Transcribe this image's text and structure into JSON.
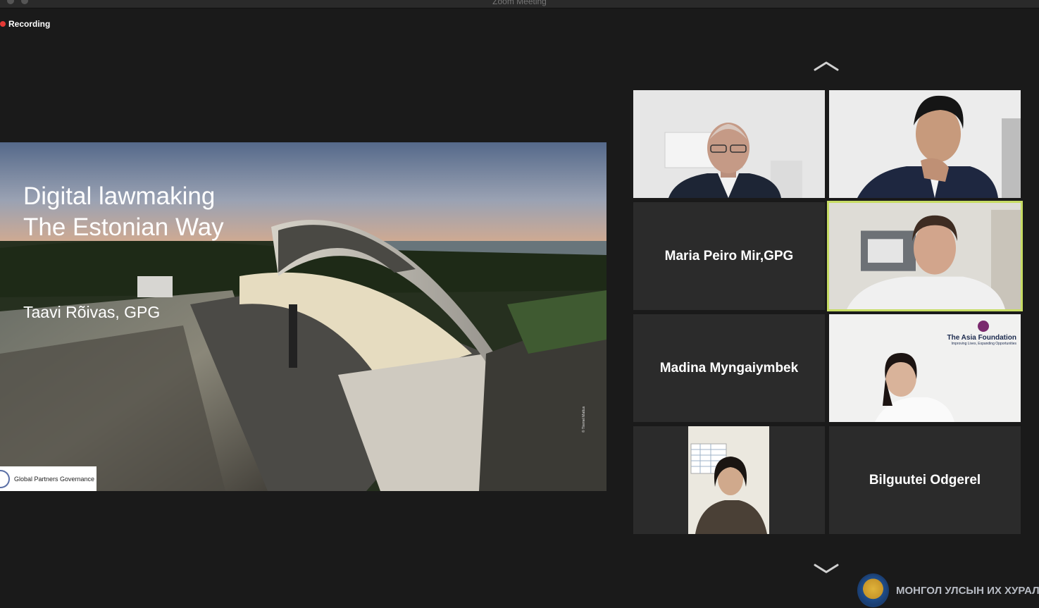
{
  "window": {
    "title": "Zoom Meeting"
  },
  "recording": {
    "label": "Recording",
    "color": "#e53935"
  },
  "slide": {
    "title_line1": "Digital lawmaking",
    "title_line2": "The Estonian Way",
    "author": "Taavi Rõivas, GPG",
    "logo_text": "Global Partners Governance",
    "credit": "© Tiiemel Mattus"
  },
  "gallery": {
    "scroll_up_icon": "chevron-up-icon",
    "scroll_down_icon": "chevron-down-icon",
    "active_speaker_border": "#c7dc64",
    "participants": [
      {
        "id": "p1",
        "name": "",
        "video": true
      },
      {
        "id": "p2",
        "name": "",
        "video": true
      },
      {
        "id": "p3",
        "name": "Maria Peiro Mir,GPG",
        "video": false
      },
      {
        "id": "p4",
        "name": "",
        "video": true,
        "active": true
      },
      {
        "id": "p5",
        "name": "Madina Myngaiymbek",
        "video": false
      },
      {
        "id": "p6",
        "name": "",
        "video": true,
        "banner_title": "The Asia Foundation",
        "banner_sub": "Improving Lives, Expanding Opportunities"
      },
      {
        "id": "p7",
        "name": "",
        "video": true
      },
      {
        "id": "p8",
        "name": "Bilguutei Odgerel",
        "video": false
      }
    ]
  },
  "watermark": {
    "text": "МОНГОЛ УЛСЫН ИХ ХУРАЛ"
  }
}
